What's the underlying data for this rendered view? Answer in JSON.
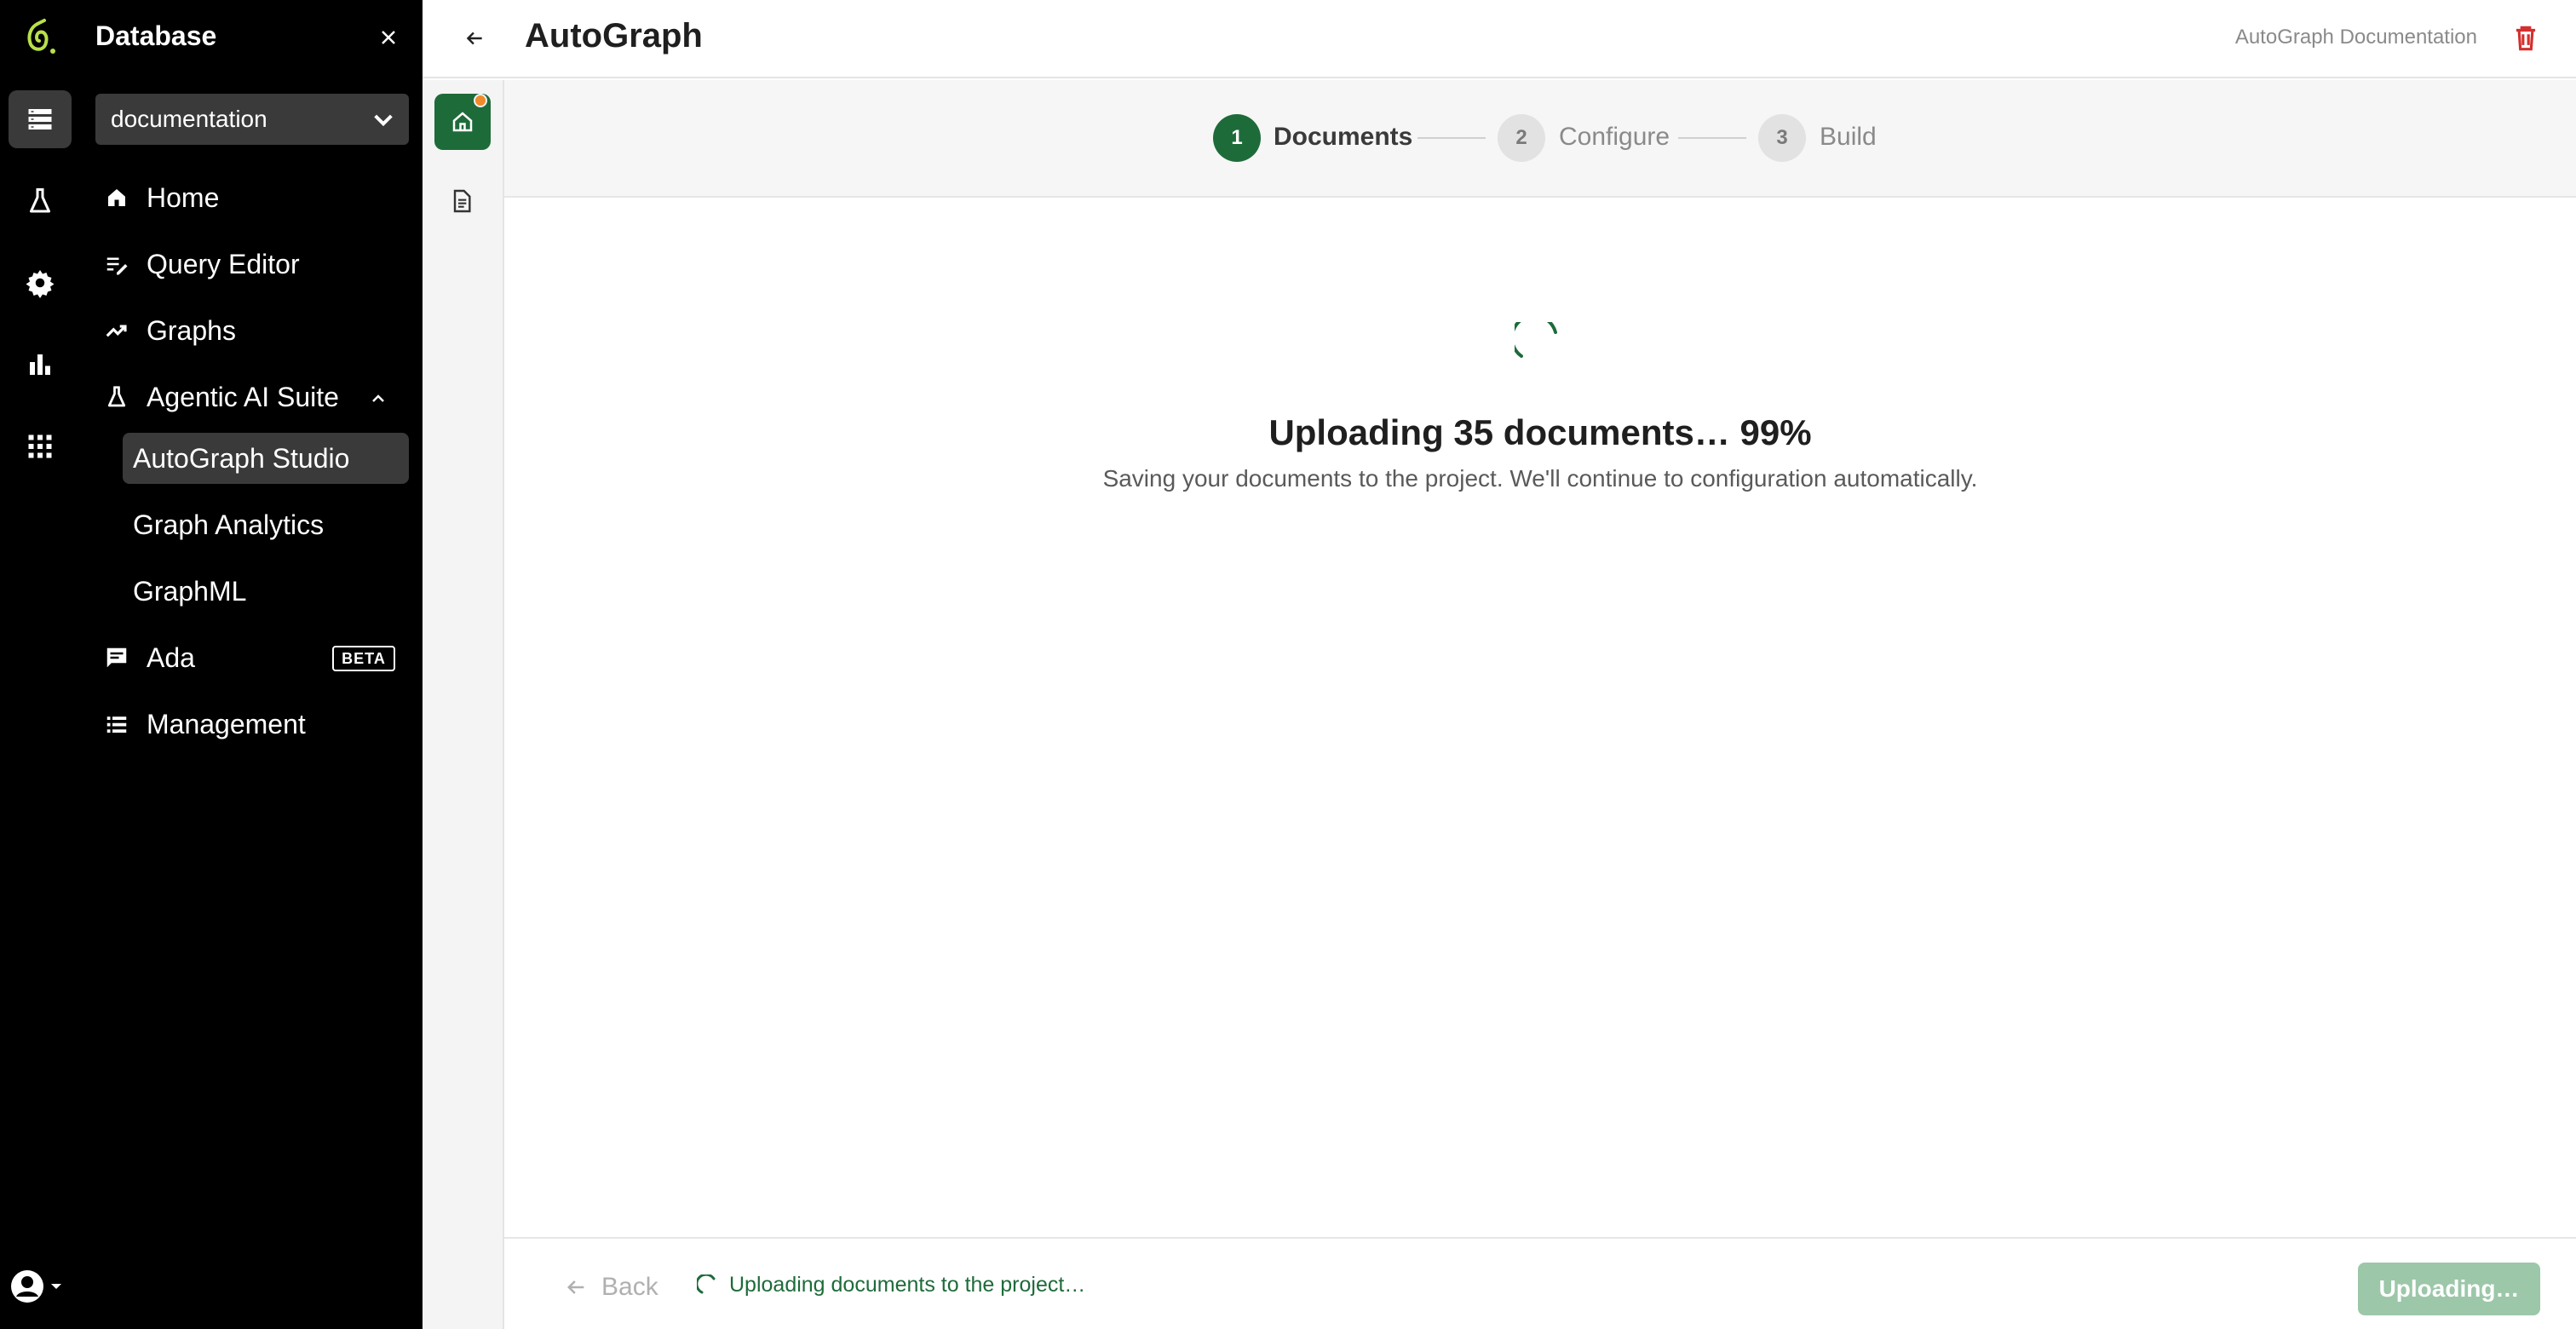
{
  "sidebar": {
    "title": "Database",
    "database_select": "documentation",
    "nav": [
      {
        "label": "Home"
      },
      {
        "label": "Query Editor"
      },
      {
        "label": "Graphs"
      },
      {
        "label": "Agentic AI Suite"
      }
    ],
    "suite_items": [
      {
        "label": "AutoGraph Studio"
      },
      {
        "label": "Graph Analytics"
      },
      {
        "label": "GraphML"
      }
    ],
    "nav_bottom": [
      {
        "label": "Ada",
        "badge": "BETA"
      },
      {
        "label": "Management"
      }
    ]
  },
  "header": {
    "title": "AutoGraph",
    "doc_link": "AutoGraph Documentation"
  },
  "stepper": {
    "steps": [
      {
        "number": "1",
        "label": "Documents"
      },
      {
        "number": "2",
        "label": "Configure"
      },
      {
        "number": "3",
        "label": "Build"
      }
    ]
  },
  "main": {
    "upload_title": "Uploading 35 documents… 99%",
    "upload_subtitle": "Saving your documents to the project. We'll continue to configuration automatically.",
    "progress_percent": 99
  },
  "footer": {
    "back_label": "Back",
    "status_text": "Uploading documents to the project…",
    "primary_button": "Uploading…"
  },
  "colors": {
    "accent": "#1e6b3a",
    "notification_dot": "#f08a2a",
    "danger": "#d32f2f"
  }
}
